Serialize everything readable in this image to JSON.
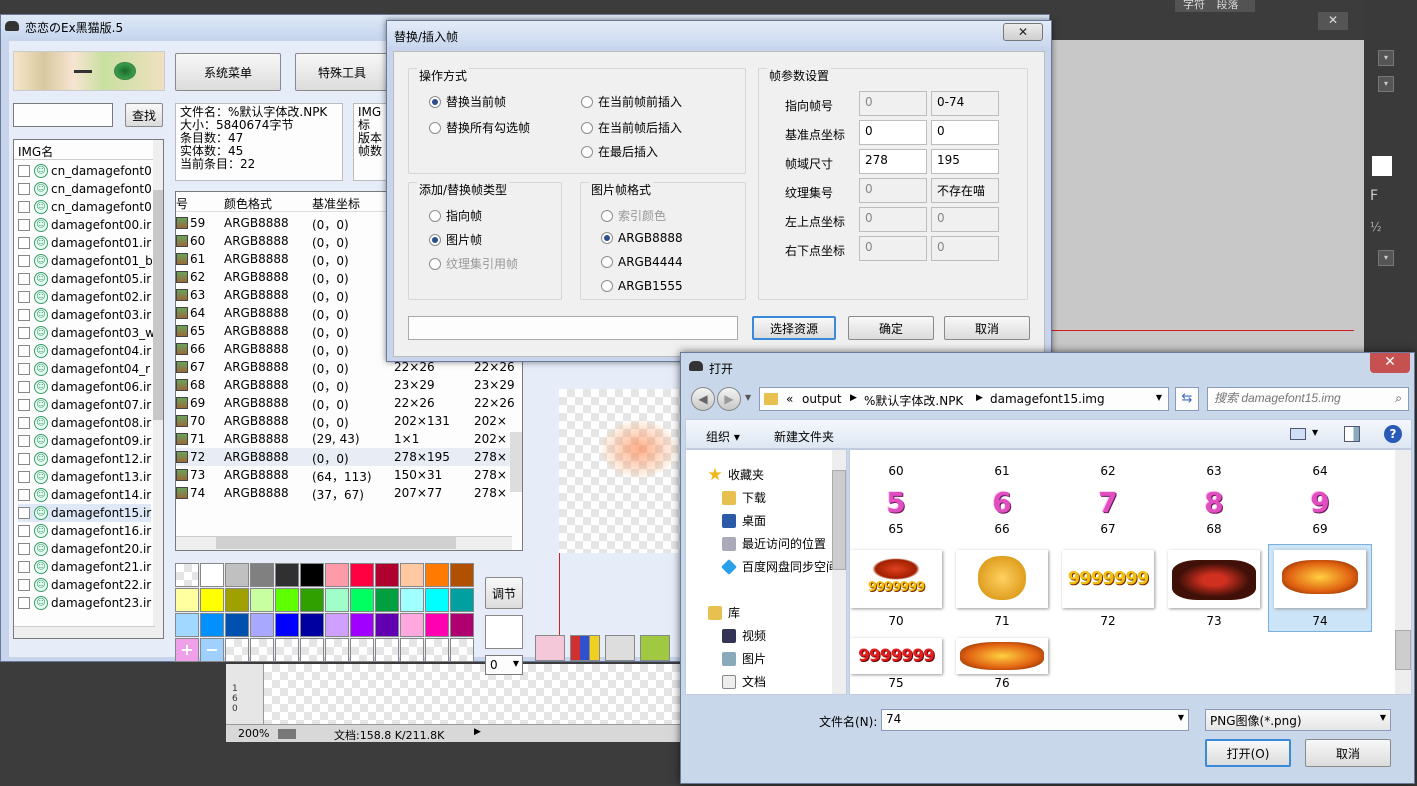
{
  "ps": {
    "tabs": [
      "字符",
      "段落"
    ],
    "status_zoom": "200%",
    "status_doc": "文档:158.8 K/211.8K",
    "ruler_digits": [
      "1",
      "6",
      "0"
    ],
    "panel_letter": "F",
    "panel_frac": "½"
  },
  "main": {
    "title": "恋恋のEx黑猫版.5",
    "menu_btn": "系统菜单",
    "special_btn": "特殊工具",
    "search_btn": "查找",
    "search_value": "",
    "info": [
      "文件名：%默认字体改.NPK",
      "大小：5840674字节",
      "条目数：47",
      "实体数：45",
      "当前条目：22"
    ],
    "info2": [
      "IMG标",
      "版本",
      "帧数"
    ],
    "img_header": "IMG名",
    "img_list": [
      "cn_damagefont0",
      "cn_damagefont0",
      "cn_damagefont0",
      "damagefont00.ir",
      "damagefont01.ir",
      "damagefont01_b",
      "damagefont05.ir",
      "damagefont02.ir",
      "damagefont03.ir",
      "damagefont03_w",
      "damagefont04.ir",
      "damagefont04_r",
      "damagefont06.ir",
      "damagefont07.ir",
      "damagefont08.ir",
      "damagefont09.ir",
      "damagefont12.ir",
      "damagefont13.ir",
      "damagefont14.ir",
      "damagefont15.ir",
      "damagefont16.ir",
      "damagefont20.ir",
      "damagefont21.ir",
      "damagefont22.ir",
      "damagefont23.ir"
    ],
    "frame_headers": [
      "号",
      "颜色格式",
      "基准坐标"
    ],
    "frames": [
      {
        "no": "59",
        "fmt": "ARGB8888",
        "pos": "(0，0)",
        "size": "",
        "area": ""
      },
      {
        "no": "60",
        "fmt": "ARGB8888",
        "pos": "(0，0)",
        "size": "",
        "area": ""
      },
      {
        "no": "61",
        "fmt": "ARGB8888",
        "pos": "(0，0)",
        "size": "",
        "area": ""
      },
      {
        "no": "62",
        "fmt": "ARGB8888",
        "pos": "(0，0)",
        "size": "",
        "area": ""
      },
      {
        "no": "63",
        "fmt": "ARGB8888",
        "pos": "(0，0)",
        "size": "",
        "area": ""
      },
      {
        "no": "64",
        "fmt": "ARGB8888",
        "pos": "(0，0)",
        "size": "",
        "area": ""
      },
      {
        "no": "65",
        "fmt": "ARGB8888",
        "pos": "(0，0)",
        "size": "",
        "area": ""
      },
      {
        "no": "66",
        "fmt": "ARGB8888",
        "pos": "(0，0)",
        "size": "",
        "area": ""
      },
      {
        "no": "67",
        "fmt": "ARGB8888",
        "pos": "(0，0)",
        "size": "22×26",
        "area": "22×26"
      },
      {
        "no": "68",
        "fmt": "ARGB8888",
        "pos": "(0，0)",
        "size": "23×29",
        "area": "23×29"
      },
      {
        "no": "69",
        "fmt": "ARGB8888",
        "pos": "(0，0)",
        "size": "22×26",
        "area": "22×26"
      },
      {
        "no": "70",
        "fmt": "ARGB8888",
        "pos": "(0，0)",
        "size": "202×131",
        "area": "202×"
      },
      {
        "no": "71",
        "fmt": "ARGB8888",
        "pos": "(29, 43)",
        "size": "1×1",
        "area": "202×"
      },
      {
        "no": "72",
        "fmt": "ARGB8888",
        "pos": "(0，0)",
        "size": "278×195",
        "area": "278×"
      },
      {
        "no": "73",
        "fmt": "ARGB8888",
        "pos": "(64，113)",
        "size": "150×31",
        "area": "278×"
      },
      {
        "no": "74",
        "fmt": "ARGB8888",
        "pos": "(37，67)",
        "size": "207×77",
        "area": "278×"
      }
    ],
    "adjust_btn": "调节",
    "zoom_select": "0",
    "palette": [
      "#ffffff",
      "#c0c0c0",
      "#808080",
      "#303030",
      "#000000",
      "#ff9aa8",
      "#ff0040",
      "#b00030",
      "#ffc8a0",
      "#ff7a00",
      "#b05000",
      "#ffffa0",
      "#ffff00",
      "#a0a000",
      "#c8ffa0",
      "#60ff00",
      "#30a000",
      "#a0ffc8",
      "#00ff60",
      "#00a040",
      "#a0ffff",
      "#00ffff",
      "#00a0a0",
      "#a0d8ff",
      "#0090ff",
      "#0050b0",
      "#a8a8ff",
      "#0000ff",
      "#0000a0",
      "#d0a0ff",
      "#a000ff",
      "#6000b0",
      "#ffa8e0",
      "#ff00b0",
      "#b00070"
    ]
  },
  "replace": {
    "title": "替换/插入帧",
    "op_group": "操作方式",
    "op_options": [
      "替换当前帧",
      "替换所有勾选帧",
      "在当前帧前插入",
      "在当前帧后插入",
      "在最后插入"
    ],
    "type_group": "添加/替换帧类型",
    "type_options": [
      "指向帧",
      "图片帧",
      "纹理集引用帧"
    ],
    "fmt_group": "图片帧格式",
    "fmt_options": [
      "索引颜色",
      "ARGB8888",
      "ARGB4444",
      "ARGB1555"
    ],
    "params_group": "帧参数设置",
    "params": [
      {
        "label": "指向帧号",
        "v1": "0",
        "v2": "0-74"
      },
      {
        "label": "基准点坐标",
        "v1": "0",
        "v2": "0"
      },
      {
        "label": "帧域尺寸",
        "v1": "278",
        "v2": "195"
      },
      {
        "label": "纹理集号",
        "v1": "0",
        "v2": "不存在喵"
      },
      {
        "label": "左上点坐标",
        "v1": "0",
        "v2": "0"
      },
      {
        "label": "右下点坐标",
        "v1": "0",
        "v2": "0"
      }
    ],
    "path_value": "",
    "choose_btn": "选择资源",
    "ok_btn": "确定",
    "cancel_btn": "取消"
  },
  "open": {
    "title": "打开",
    "crumbs": [
      "«",
      "output",
      "%默认字体改.NPK",
      "damagefont15.img"
    ],
    "search_placeholder": "搜索 damagefont15.img",
    "organize": "组织 ▾",
    "new_folder": "新建文件夹",
    "nav": [
      "收藏夹",
      "下载",
      "桌面",
      "最近访问的位置",
      "百度网盘同步空间",
      "库",
      "视频",
      "图片",
      "文档"
    ],
    "row1_labels": [
      "60",
      "61",
      "62",
      "63",
      "64"
    ],
    "row2_labels": [
      "65",
      "66",
      "67",
      "68",
      "69"
    ],
    "row2_glyphs": [
      "5",
      "6",
      "7",
      "8",
      "9"
    ],
    "row3_labels": [
      "70",
      "71",
      "72",
      "73",
      "74"
    ],
    "row4_labels": [
      "75",
      "76"
    ],
    "big_text": "9999999",
    "filename_label": "文件名(N):",
    "filename_value": "74",
    "filetype": "PNG图像(*.png)",
    "open_btn": "打开(O)",
    "cancel_btn": "取消"
  }
}
